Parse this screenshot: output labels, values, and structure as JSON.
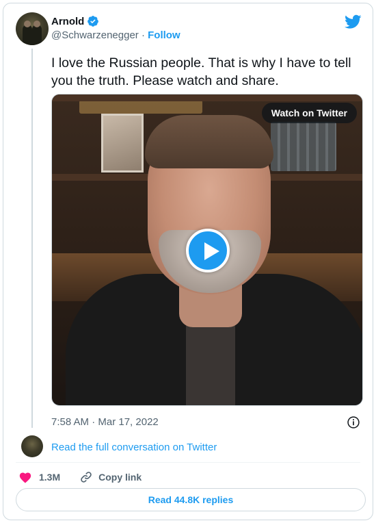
{
  "author": {
    "name": "Arnold",
    "handle": "@Schwarzenegger",
    "separator": "·",
    "follow_label": "Follow",
    "verified": true
  },
  "tweet": {
    "text": "I love the Russian people. That is why I have to tell you the truth. Please watch and share."
  },
  "media": {
    "watch_label": "Watch on Twitter"
  },
  "meta": {
    "timestamp": "7:58 AM · Mar 17, 2022"
  },
  "conversation": {
    "read_full_label": "Read the full conversation on Twitter"
  },
  "actions": {
    "likes": "1.3M",
    "copy_link_label": "Copy link",
    "read_replies_label": "Read 44.8K replies"
  },
  "colors": {
    "accent": "#1d9bf0",
    "like": "#f91880",
    "text": "#0f1419",
    "secondary": "#536471",
    "border": "#cfd9de"
  },
  "icons": {
    "brand": "twitter-bird-icon",
    "verified": "verified-badge-icon",
    "info": "info-icon",
    "like": "heart-icon",
    "copy": "link-icon",
    "play": "play-icon"
  }
}
